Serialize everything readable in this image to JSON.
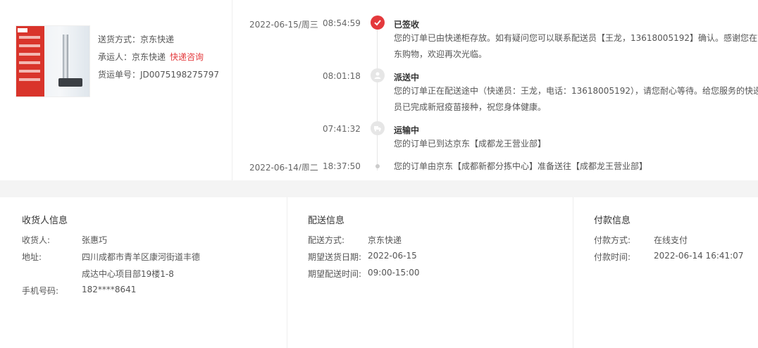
{
  "shipment": {
    "method_label": "送货方式：",
    "method": "京东快递",
    "carrier_label": "承运人：",
    "carrier": "京东快递",
    "carrier_link": "快递咨询",
    "waybill_label": "货运单号：",
    "waybill": "JD0075198275797"
  },
  "timeline": [
    {
      "date": "2022-06-15/周三",
      "time": "08:54:59",
      "status": "已签收",
      "lines": [
        "您的订单已由快递柜存放。如有疑问您可以联系配送员【王龙，13618005192】确认。感谢您在京",
        "东购物，欢迎再次光临。"
      ]
    },
    {
      "date": "",
      "time": "08:01:18",
      "status": "派送中",
      "lines": [
        "您的订单正在配送途中（快递员：王龙，电话：13618005192），请您耐心等待。给您服务的快递",
        "员已完成新冠疫苗接种，祝您身体健康。"
      ]
    },
    {
      "date": "",
      "time": "07:41:32",
      "status": "运输中",
      "lines": [
        "您的订单已到达京东【成都龙王营业部】"
      ]
    },
    {
      "date": "2022-06-14/周二",
      "time": "18:37:50",
      "status": "",
      "lines": [
        "您的订单由京东【成都新都分拣中心】准备送往【成都龙王营业部】"
      ]
    }
  ],
  "consignee": {
    "title": "收货人信息",
    "name_label": "收货人:",
    "name": "张惠巧",
    "address_label": "地址:",
    "address_line1": "四川成都市青羊区康河街道丰德",
    "address_line2": "成达中心项目部19楼1-8",
    "phone_label": "手机号码:",
    "phone": "182****8641"
  },
  "delivery": {
    "title": "配送信息",
    "method_label": "配送方式:",
    "method": "京东快递",
    "date_label": "期望送货日期:",
    "date": "2022-06-15",
    "time_label": "期望配送时间:",
    "time": "09:00-15:00"
  },
  "payment": {
    "title": "付款信息",
    "method_label": "付款方式:",
    "method": "在线支付",
    "time_label": "付款时间:",
    "time": "2022-06-14 16:41:07"
  },
  "colors": {
    "accent": "#e4393c",
    "muted": "#e6e6e6"
  }
}
